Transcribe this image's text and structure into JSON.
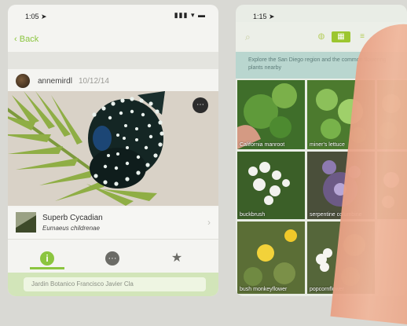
{
  "left_screen": {
    "status_time": "1:05 ➤",
    "status_icons": "▮▮▮ ▾ ▬",
    "back_label": "Back",
    "observer": {
      "username": "annemirdl",
      "date": "10/12/14"
    },
    "taxon": {
      "common_name": "Superb Cycadian",
      "scientific_name": "Eumaeus childrenae"
    },
    "tabs": [
      {
        "name": "info",
        "glyph": "i"
      },
      {
        "name": "activity",
        "glyph": "···"
      },
      {
        "name": "favorite",
        "glyph": "★"
      }
    ],
    "location_placeholder": "Jardin Botanico Francisco Javier Cla"
  },
  "right_screen": {
    "status_time": "1:15 ➤",
    "info_text": "Explore the San Diego region and the common flowering plants nearby",
    "grid_items": [
      {
        "label": "California manroot"
      },
      {
        "label": "miner's lettuce"
      },
      {
        "label": ""
      },
      {
        "label": "buckbrush"
      },
      {
        "label": "serpentine columbine"
      },
      {
        "label": ""
      },
      {
        "label": "bush monkeyflower"
      },
      {
        "label": "popcornflower"
      }
    ]
  },
  "colors": {
    "accent": "#8bc53f",
    "location_bar": "#d2e5b9",
    "info_band": "#b9d6cf"
  },
  "icons": {
    "photo_menu": "more-icon",
    "search": "search-icon",
    "view_map": "map-icon",
    "view_grid": "grid-icon",
    "view_list": "list-icon"
  }
}
